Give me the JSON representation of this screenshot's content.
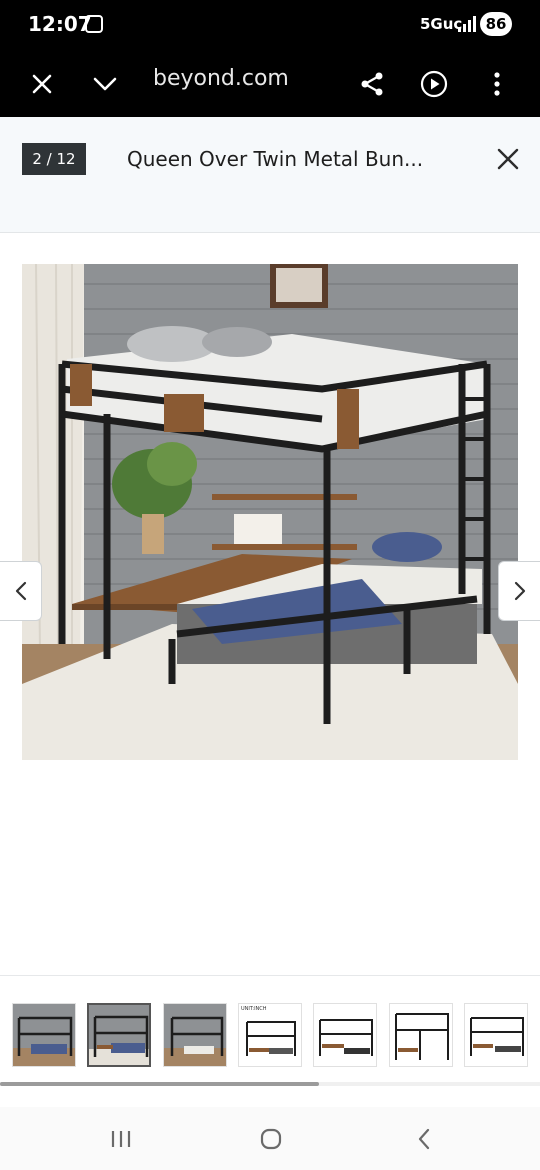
{
  "status_bar": {
    "time": "12:07",
    "network": "5Guc",
    "battery": "86"
  },
  "browser": {
    "url": "beyond.com",
    "icons": [
      "close-icon",
      "chevron-down-icon",
      "share-icon",
      "play-icon",
      "more-vertical-icon"
    ]
  },
  "gallery": {
    "counter": "2 / 12",
    "title": "Queen Over Twin Metal Bun...",
    "selected_index": 1,
    "thumbnails_visible": 7,
    "thumbnail_scroll_fraction": 0.59
  },
  "thumbnails": [
    {
      "label": ""
    },
    {
      "label": ""
    },
    {
      "label": ""
    },
    {
      "label": "UNIT:INCH"
    },
    {
      "label": ""
    },
    {
      "label": ""
    },
    {
      "label": ""
    }
  ],
  "system_nav": {
    "icons": [
      "recent-apps-icon",
      "home-icon",
      "back-icon"
    ]
  }
}
